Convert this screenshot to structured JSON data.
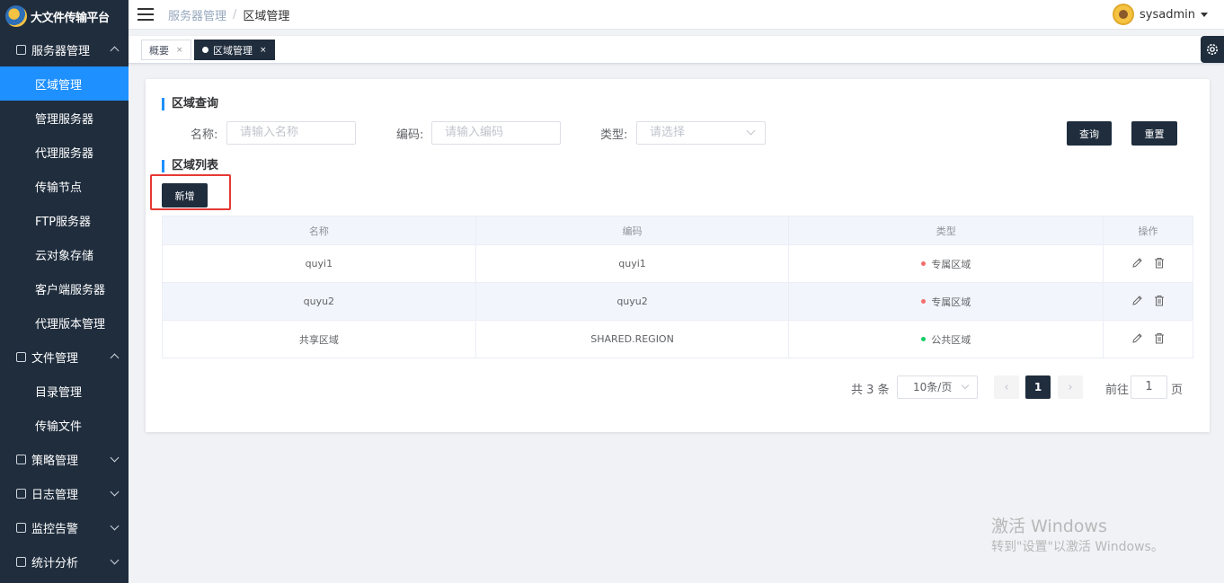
{
  "app": {
    "title": "大文件传输平台"
  },
  "sidebar": {
    "groups": [
      {
        "label": "服务器管理",
        "icon": "cube-icon",
        "expanded": true,
        "items": [
          "区域管理",
          "管理服务器",
          "代理服务器",
          "传输节点",
          "FTP服务器",
          "云对象存储",
          "客户端服务器",
          "代理版本管理"
        ]
      },
      {
        "label": "文件管理",
        "icon": "layers-icon",
        "expanded": true,
        "items": [
          "目录管理",
          "传输文件"
        ]
      },
      {
        "label": "策略管理",
        "icon": "policy-icon",
        "expanded": false
      },
      {
        "label": "日志管理",
        "icon": "log-icon",
        "expanded": false
      },
      {
        "label": "监控告警",
        "icon": "monitor-icon",
        "expanded": false
      },
      {
        "label": "统计分析",
        "icon": "stats-icon",
        "expanded": false
      }
    ],
    "active_item": "区域管理"
  },
  "header": {
    "breadcrumb": [
      "服务器管理",
      "区域管理"
    ],
    "separator": "/",
    "username": "sysadmin"
  },
  "tabs": [
    {
      "label": "概要",
      "close": "×"
    },
    {
      "label": "区域管理",
      "close": "×",
      "active": true
    }
  ],
  "query": {
    "title": "区域查询",
    "name_label": "名称:",
    "name_placeholder": "请输入名称",
    "code_label": "编码:",
    "code_placeholder": "请输入编码",
    "type_label": "类型:",
    "type_placeholder": "请选择",
    "search_button": "查询",
    "reset_button": "重置"
  },
  "list": {
    "title": "区域列表",
    "add_button": "新增",
    "columns": [
      "名称",
      "编码",
      "类型",
      "操作"
    ],
    "rows": [
      {
        "name": "quyi1",
        "code": "quyi1",
        "type": "专属区域",
        "type_color": "#f56c6c"
      },
      {
        "name": "quyu2",
        "code": "quyu2",
        "type": "专属区域",
        "type_color": "#f56c6c"
      },
      {
        "name": "共享区域",
        "code": "SHARED.REGION",
        "type": "公共区域",
        "type_color": "#13ce66"
      }
    ]
  },
  "pagination": {
    "total_text": "共 3 条",
    "page_size": "10条/页",
    "current_page": "1",
    "prev": "‹",
    "next": "›",
    "goto_label": "前往",
    "goto_value": "1",
    "page_suffix": "页"
  },
  "watermark": {
    "line1": "激活 Windows",
    "line2": "转到\"设置\"以激活 Windows。"
  },
  "colors": {
    "sidebar_bg": "#1f2d3d",
    "active": "#1e90ff",
    "highlight": "#e53935"
  }
}
